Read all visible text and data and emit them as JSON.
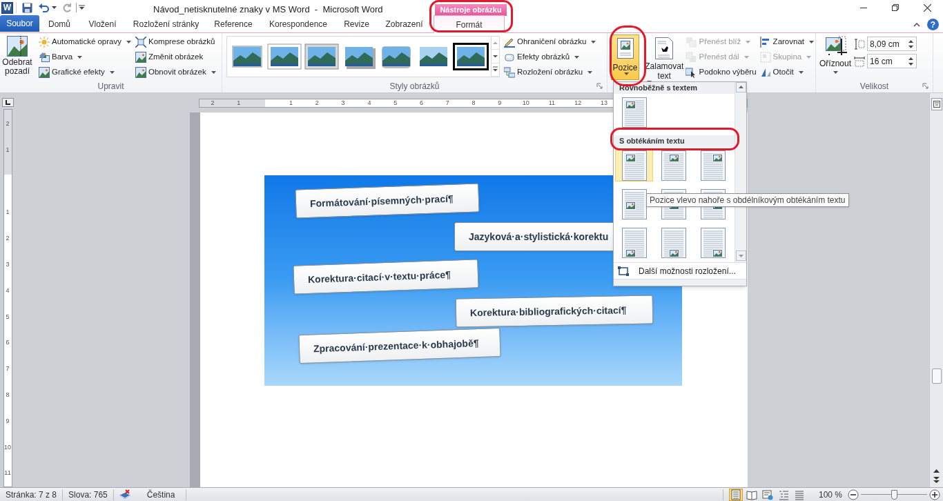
{
  "window": {
    "app_letter": "W",
    "title": "Návod_netisknutelné znaky v MS Word  -  Microsoft Word",
    "context_group": "Nástroje obrázku",
    "help": "?"
  },
  "tabs": [
    {
      "label": "Soubor",
      "kind": "file",
      "selected": false
    },
    {
      "label": "Domů",
      "kind": "normal",
      "selected": false
    },
    {
      "label": "Vložení",
      "kind": "normal",
      "selected": false
    },
    {
      "label": "Rozložení stránky",
      "kind": "normal",
      "selected": false
    },
    {
      "label": "Reference",
      "kind": "normal",
      "selected": false
    },
    {
      "label": "Korespondence",
      "kind": "normal",
      "selected": false
    },
    {
      "label": "Revize",
      "kind": "normal",
      "selected": false
    },
    {
      "label": "Zobrazení",
      "kind": "normal",
      "selected": false
    },
    {
      "label": "Formát",
      "kind": "context",
      "selected": true
    }
  ],
  "adjust_group": {
    "label": "Upravit",
    "large_button": "Odebrat pozadí",
    "commands": [
      {
        "label": "Automatické opravy",
        "dropdown": true
      },
      {
        "label": "Barva",
        "dropdown": true
      },
      {
        "label": "Grafické efekty",
        "dropdown": true
      },
      {
        "label": "Komprese obrázků",
        "dropdown": false
      },
      {
        "label": "Změnit obrázek",
        "dropdown": false
      },
      {
        "label": "Obnovit obrázek",
        "dropdown": true
      }
    ]
  },
  "styles_group": {
    "label": "Styly obrázků",
    "styles": [
      {
        "kind": "simple"
      },
      {
        "kind": "white-frame"
      },
      {
        "kind": "gray-frame"
      },
      {
        "kind": "shadow"
      },
      {
        "kind": "rounded"
      },
      {
        "kind": "soft-edge"
      },
      {
        "kind": "black-frame"
      }
    ],
    "commands": [
      {
        "label": "Ohraničení obrázku",
        "dropdown": true
      },
      {
        "label": "Efekty obrázků",
        "dropdown": true
      },
      {
        "label": "Rozložení obrázku",
        "dropdown": true
      }
    ]
  },
  "arrange_group": {
    "position_button": {
      "label": "Pozice",
      "pressed": true
    },
    "wrap_button": {
      "label": "Zalamovat text"
    },
    "commands": [
      {
        "label": "Přenést blíž",
        "dropdown": true,
        "disabled": true
      },
      {
        "label": "Přenést dál",
        "dropdown": true,
        "disabled": true
      },
      {
        "label": "Podokno výběru",
        "dropdown": false,
        "disabled": false
      },
      {
        "label": "Zarovnat",
        "dropdown": true,
        "disabled": false
      },
      {
        "label": "Skupina",
        "dropdown": true,
        "disabled": true
      },
      {
        "label": "Otočit",
        "dropdown": true,
        "disabled": false
      }
    ]
  },
  "size_group": {
    "label": "Velikost",
    "crop_button": "Oříznout",
    "height": "8,09 cm",
    "width": "16 cm"
  },
  "horizontal_ruler": {
    "before": [
      "2",
      "1"
    ],
    "after": [
      "1",
      "2",
      "3",
      "4",
      "5",
      "6",
      "7",
      "8",
      "9",
      "10",
      "11",
      "12",
      "13"
    ]
  },
  "vertical_ruler": {
    "before": [
      "2",
      "1"
    ],
    "after": [
      "1",
      "2",
      "3",
      "4",
      "5",
      "6",
      "7",
      "8",
      "9",
      "10",
      "11"
    ]
  },
  "picture": {
    "banners": [
      {
        "text": "Formátování·písemných·prací¶"
      },
      {
        "text": "Jazyková·a·stylistická·korektu"
      },
      {
        "text": "Korektura·citací·v·textu·práce¶"
      },
      {
        "text": "Korektura·bibliografických·citací¶"
      },
      {
        "text": "Zpracování·prezentace·k·obhajobě¶"
      }
    ]
  },
  "position_menu": {
    "sections": [
      {
        "header": "Rovnoběžně s textem",
        "items": [
          {
            "highlighted": false
          }
        ]
      },
      {
        "header": "S obtékáním textu",
        "items": [
          {
            "highlighted": true
          },
          {
            "highlighted": false
          },
          {
            "highlighted": false
          },
          {
            "highlighted": false
          },
          {
            "highlighted": false
          },
          {
            "highlighted": false
          },
          {
            "highlighted": false
          },
          {
            "highlighted": false
          },
          {
            "highlighted": false
          }
        ]
      }
    ],
    "more_options": "Další možnosti rozložení..."
  },
  "tooltip": "Pozice vlevo nahoře s obdélníkovým obtékáním textu",
  "annotation_rings": [
    {
      "shown": true
    },
    {
      "shown": true
    },
    {
      "shown": true
    }
  ],
  "status_bar": {
    "page": "Stránka: 7 z 8",
    "words": "Slova: 765",
    "language": "Čeština",
    "views": [
      {
        "kind": "print-layout",
        "selected": true
      },
      {
        "kind": "reading",
        "selected": false
      },
      {
        "kind": "web",
        "selected": false
      },
      {
        "kind": "outline",
        "selected": false
      },
      {
        "kind": "draft",
        "selected": false
      }
    ],
    "zoom": "100 %",
    "zoom_slider": {
      "level": 0.5
    }
  }
}
